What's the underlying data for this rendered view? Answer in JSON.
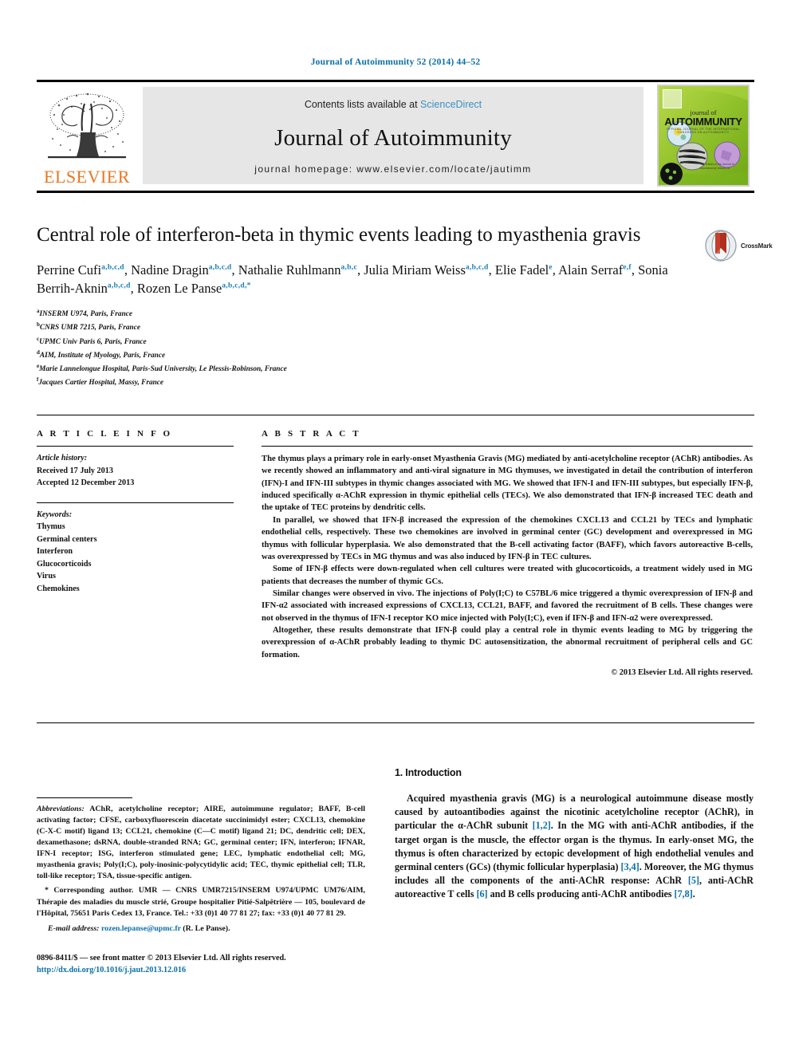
{
  "running_head": "Journal of Autoimmunity 52 (2014) 44–52",
  "masthead": {
    "publisher_logo_label": "ELSEVIER",
    "contents_prefix": "Contents lists available at",
    "sciencedirect": "ScienceDirect",
    "journal_name": "Journal of Autoimmunity",
    "homepage": "journal homepage: www.elsevier.com/locate/jautimm",
    "cover": {
      "line1": "journal of",
      "line2": "AUTOIMMUNITY",
      "subtitle": "OFFICIAL JOURNAL OF THE INTERNATIONAL CONGRESS ON AUTOIMMUNITY",
      "footer": "The Editors of the Journal of Autoimmunity  Volume 52"
    }
  },
  "article": {
    "title": "Central role of interferon-beta in thymic events leading to myasthenia gravis",
    "crossmark_label": "CrossMark",
    "authors": [
      {
        "name": "Perrine Cufi",
        "sup": "a,b,c,d",
        "sep": ", "
      },
      {
        "name": "Nadine Dragin",
        "sup": "a,b,c,d",
        "sep": ", "
      },
      {
        "name": "Nathalie Ruhlmann",
        "sup": "a,b,c",
        "sep": ", "
      },
      {
        "name": "Julia Miriam Weiss",
        "sup": "a,b,c,d",
        "sep": ", "
      },
      {
        "name": "Elie Fadel",
        "sup": "e",
        "sep": ", "
      },
      {
        "name": "Alain Serraf",
        "sup": "e,f",
        "sep": ", "
      },
      {
        "name": "Sonia Berrih-Aknin",
        "sup": "a,b,c,d",
        "sep": ", "
      },
      {
        "name": "Rozen Le Panse",
        "sup": "a,b,c,d,*",
        "sep": ""
      }
    ],
    "affiliations": [
      {
        "mark": "a",
        "text": "INSERM U974, Paris, France"
      },
      {
        "mark": "b",
        "text": "CNRS UMR 7215, Paris, France"
      },
      {
        "mark": "c",
        "text": "UPMC Univ Paris 6, Paris, France"
      },
      {
        "mark": "d",
        "text": "AIM, Institute of Myology, Paris, France"
      },
      {
        "mark": "e",
        "text": "Marie Lannelongue Hospital, Paris-Sud University, Le Plessis-Robinson, France"
      },
      {
        "mark": "f",
        "text": "Jacques Cartier Hospital, Massy, France"
      }
    ]
  },
  "article_info": {
    "heading": "A R T I C L E  I N F O",
    "history_label": "Article history:",
    "received": "Received 17 July 2013",
    "accepted": "Accepted 12 December 2013",
    "keywords_label": "Keywords:",
    "keywords": [
      "Thymus",
      "Germinal centers",
      "Interferon",
      "Glucocorticoids",
      "Virus",
      "Chemokines"
    ]
  },
  "abstract": {
    "heading": "A B S T R A C T",
    "paragraphs": [
      "The thymus plays a primary role in early-onset Myasthenia Gravis (MG) mediated by anti-acetylcholine receptor (AChR) antibodies. As we recently showed an inflammatory and anti-viral signature in MG thymuses, we investigated in detail the contribution of interferon (IFN)-I and IFN-III subtypes in thymic changes associated with MG. We showed that IFN-I and IFN-III subtypes, but especially IFN-β, induced specifically α-AChR expression in thymic epithelial cells (TECs). We also demonstrated that IFN-β increased TEC death and the uptake of TEC proteins by dendritic cells.",
      "In parallel, we showed that IFN-β increased the expression of the chemokines CXCL13 and CCL21 by TECs and lymphatic endothelial cells, respectively. These two chemokines are involved in germinal center (GC) development and overexpressed in MG thymus with follicular hyperplasia. We also demonstrated that the B-cell activating factor (BAFF), which favors autoreactive B-cells, was overexpressed by TECs in MG thymus and was also induced by IFN-β in TEC cultures.",
      "Some of IFN-β effects were down-regulated when cell cultures were treated with glucocorticoids, a treatment widely used in MG patients that decreases the number of thymic GCs.",
      "Similar changes were observed in vivo. The injections of Poly(I;C) to C57BL/6 mice triggered a thymic overexpression of IFN-β and IFN-α2 associated with increased expressions of CXCL13, CCL21, BAFF, and favored the recruitment of B cells. These changes were not observed in the thymus of IFN-I receptor KO mice injected with Poly(I;C), even if IFN-β and IFN-α2 were overexpressed.",
      "Altogether, these results demonstrate that IFN-β could play a central role in thymic events leading to MG by triggering the overexpression of α-AChR probably leading to thymic DC autosensitization, the abnormal recruitment of peripheral cells and GC formation."
    ],
    "copyright": "© 2013 Elsevier Ltd. All rights reserved."
  },
  "footnotes": {
    "abbreviations_label": "Abbreviations:",
    "abbreviations_text": "AChR, acetylcholine receptor; AIRE, autoimmune regulator; BAFF, B-cell activating factor; CFSE, carboxyfluorescein diacetate succinimidyl ester; CXCL13, chemokine (C-X-C motif) ligand 13; CCL21, chemokine (C—C motif) ligand 21; DC, dendritic cell; DEX, dexamethasone; dsRNA, double-stranded RNA; GC, germinal center; IFN, interferon; IFNAR, IFN-I receptor; ISG, interferon stimulated gene; LEC, lymphatic endothelial cell; MG, myasthenia gravis; Poly(I;C), poly-inosinic-polycytidylic acid; TEC, thymic epithelial cell; TLR, toll-like receptor; TSA, tissue-specific antigen.",
    "corresponding_text": "* Corresponding author. UMR — CNRS UMR7215/INSERM U974/UPMC UM76/AIM, Thérapie des maladies du muscle strié, Groupe hospitalier Pitié-Salpêtrière — 105, boulevard de l'Hôpital, 75651 Paris Cedex 13, France. Tel.: +33 (0)1 40 77 81 27; fax: +33 (0)1 40 77 81 29.",
    "email_label": "E-mail address:",
    "email": "rozen.lepanse@upmc.fr",
    "email_suffix": "(R. Le Panse).",
    "front_matter": "0896-8411/$ — see front matter © 2013 Elsevier Ltd. All rights reserved.",
    "doi": "http://dx.doi.org/10.1016/j.jaut.2013.12.016"
  },
  "introduction": {
    "heading": "1.  Introduction",
    "paragraph_parts": [
      "Acquired myasthenia gravis (MG) is a neurological autoimmune disease mostly caused by autoantibodies against the nicotinic acetylcholine receptor (AChR), in particular the α-AChR subunit ",
      "[1,2]",
      ". In the MG with anti-AChR antibodies, if the target organ is the muscle, the effector organ is the thymus. In early-onset MG, the thymus is often characterized by ectopic development of high endothelial venules and germinal centers (GCs) (thymic follicular hyperplasia) ",
      "[3,4]",
      ". Moreover, the MG thymus includes all the components of the anti-AChR response: AChR ",
      "[5]",
      ", anti-AChR autoreactive T cells ",
      "[6]",
      " and B cells producing anti-AChR antibodies ",
      "[7,8]",
      "."
    ]
  },
  "colors": {
    "link": "#0b6ea8",
    "elsevier_orange": "#E87722",
    "sciencedirect_blue": "#3a8fc4",
    "superscript_blue": "#1a7fb5",
    "masthead_grey": "#e6e6e6",
    "cover_green": "#8fbf2a"
  }
}
